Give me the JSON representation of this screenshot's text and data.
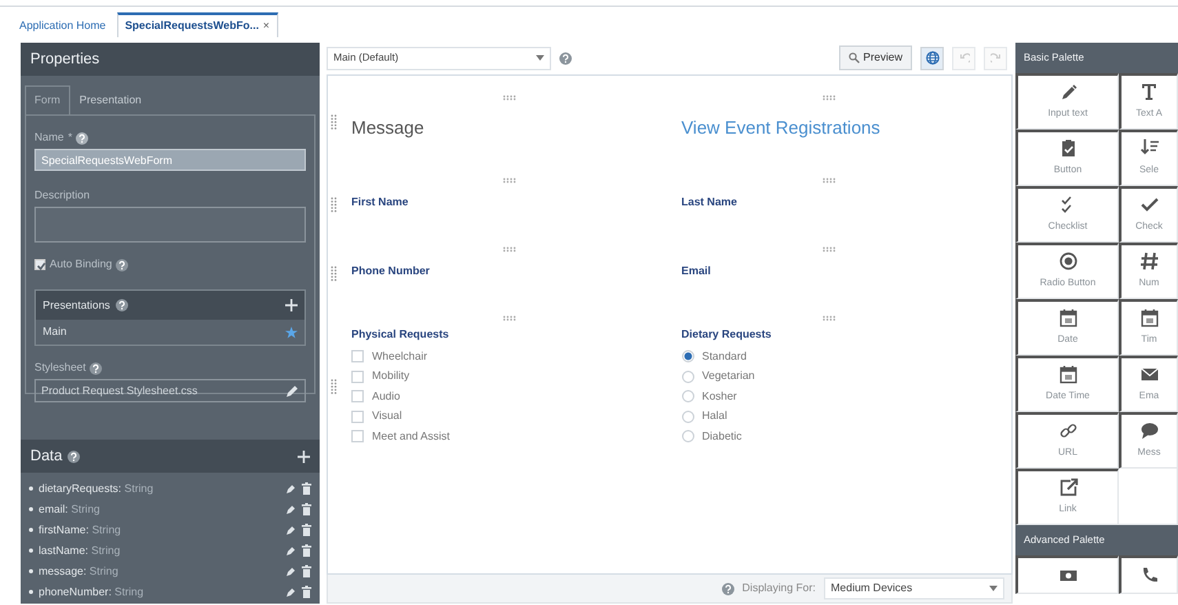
{
  "tabs": [
    {
      "label": "Application Home",
      "selected": false
    },
    {
      "label": "SpecialRequestsWebFo...",
      "selected": true,
      "close": "×"
    }
  ],
  "properties": {
    "title": "Properties",
    "tabs": [
      {
        "label": "Form",
        "selected": true
      },
      {
        "label": "Presentation",
        "selected": false
      }
    ],
    "name": {
      "label": "Name",
      "required": "*",
      "value": "SpecialRequestsWebForm"
    },
    "description": {
      "label": "Description"
    },
    "auto_binding": {
      "label": "Auto Binding",
      "checked": true
    },
    "presentations": {
      "title": "Presentations",
      "items": [
        {
          "label": "Main",
          "default": true
        }
      ]
    },
    "stylesheet": {
      "label": "Stylesheet",
      "value": "Product Request Stylesheet.css"
    }
  },
  "data": {
    "title": "Data",
    "fields": [
      {
        "name": "dietaryRequests:",
        "type": "String"
      },
      {
        "name": "email:",
        "type": "String"
      },
      {
        "name": "firstName:",
        "type": "String"
      },
      {
        "name": "lastName:",
        "type": "String"
      },
      {
        "name": "message:",
        "type": "String"
      },
      {
        "name": "phoneNumber:",
        "type": "String"
      }
    ]
  },
  "toolbar": {
    "presentation": "Main (Default)",
    "preview": "Preview",
    "undo_disabled": true,
    "redo_disabled": true
  },
  "canvas": {
    "rows": [
      {
        "cells": [
          {
            "kind": "heading",
            "text": "Message"
          },
          {
            "kind": "link",
            "text": "View Event Registrations"
          }
        ]
      },
      {
        "cells": [
          {
            "kind": "field",
            "text": "First Name"
          },
          {
            "kind": "field",
            "text": "Last Name"
          }
        ]
      },
      {
        "cells": [
          {
            "kind": "field",
            "text": "Phone Number"
          },
          {
            "kind": "field",
            "text": "Email"
          }
        ]
      },
      {
        "cells": [
          {
            "kind": "checklist",
            "text": "Physical Requests",
            "options": [
              {
                "label": "Wheelchair",
                "checked": false
              },
              {
                "label": "Mobility",
                "checked": false
              },
              {
                "label": "Audio",
                "checked": false
              },
              {
                "label": "Visual",
                "checked": false
              },
              {
                "label": "Meet and Assist",
                "checked": false
              }
            ]
          },
          {
            "kind": "radio",
            "text": "Dietary Requests",
            "options": [
              {
                "label": "Standard",
                "selected": true
              },
              {
                "label": "Vegetarian",
                "selected": false
              },
              {
                "label": "Kosher",
                "selected": false
              },
              {
                "label": "Halal",
                "selected": false
              },
              {
                "label": "Diabetic",
                "selected": false
              }
            ]
          }
        ]
      }
    ]
  },
  "footer": {
    "label": "Displaying For:",
    "device": "Medium Devices"
  },
  "basic_palette": {
    "title": "Basic Palette",
    "items": [
      {
        "kind": "input_text",
        "label": "Input text"
      },
      {
        "kind": "text_area",
        "label": "Text A"
      },
      {
        "kind": "button",
        "label": "Button"
      },
      {
        "kind": "select",
        "label": "Sele"
      },
      {
        "kind": "checklist",
        "label": "Checklist"
      },
      {
        "kind": "checkbox",
        "label": "Check"
      },
      {
        "kind": "radio",
        "label": "Radio Button"
      },
      {
        "kind": "number",
        "label": "Num"
      },
      {
        "kind": "date",
        "label": "Date"
      },
      {
        "kind": "time",
        "label": "Tim"
      },
      {
        "kind": "datetime",
        "label": "Date Time"
      },
      {
        "kind": "email",
        "label": "Ema"
      },
      {
        "kind": "url",
        "label": "URL"
      },
      {
        "kind": "message",
        "label": "Mess"
      },
      {
        "kind": "link",
        "label": "Link"
      }
    ]
  },
  "advanced_palette": {
    "title": "Advanced Palette",
    "items": [
      {
        "kind": "currency"
      },
      {
        "kind": "phone"
      }
    ]
  }
}
